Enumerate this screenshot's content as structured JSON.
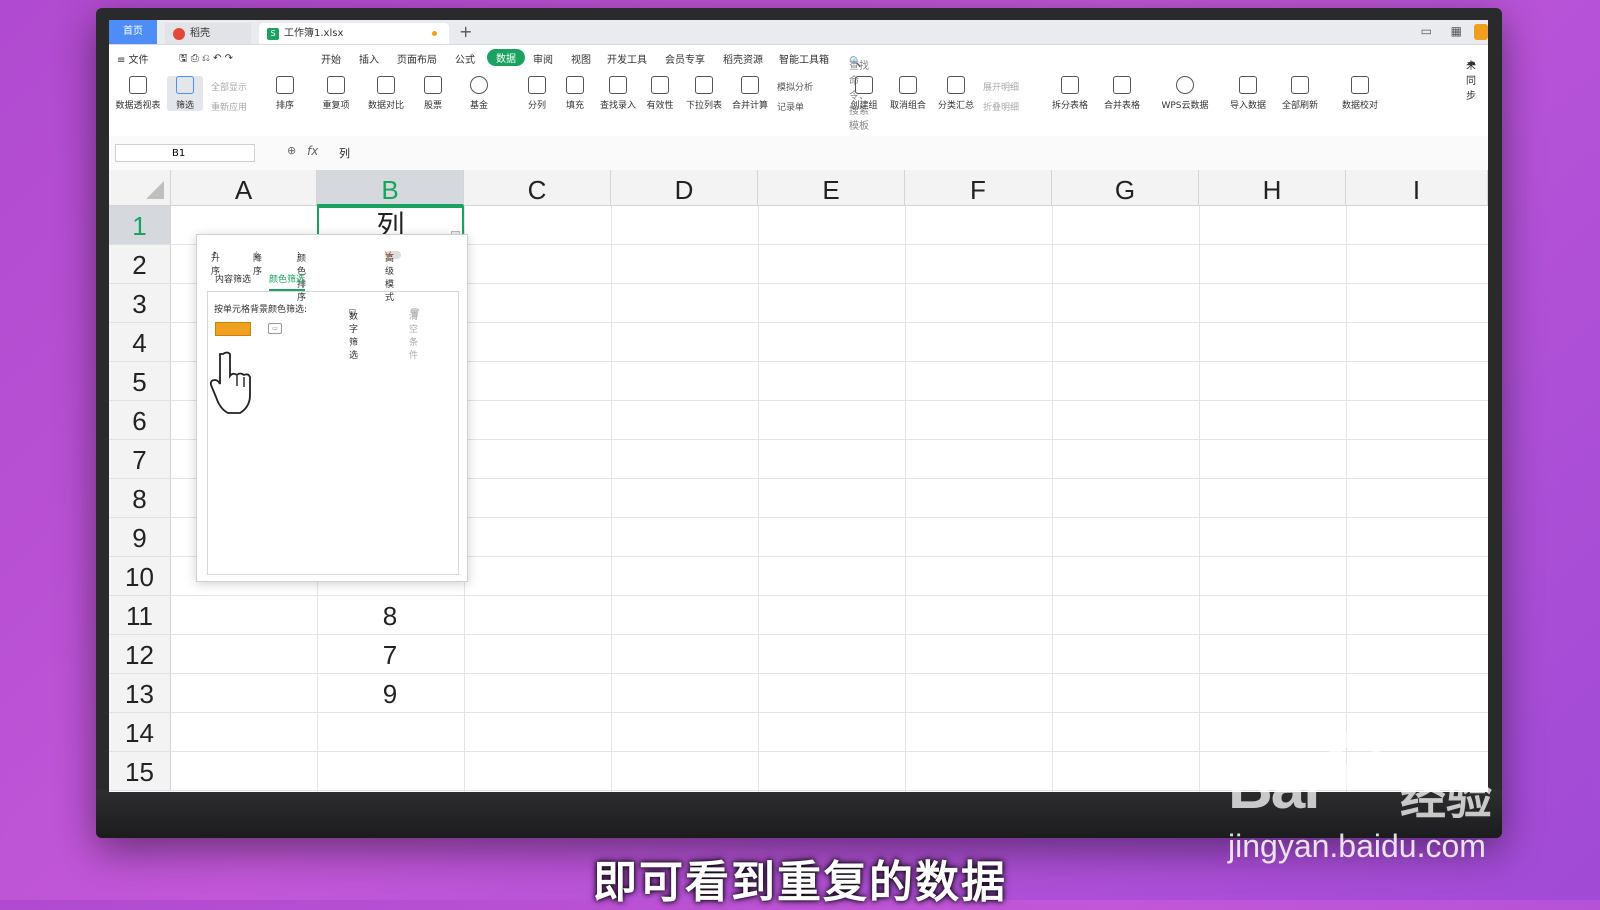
{
  "titlebar": {
    "home_tab": "首页",
    "doc_tab_1": "稻壳",
    "doc_tab_2": "工作簿1.xlsx",
    "new_tab": "+"
  },
  "menubar": {
    "file": "≡ 文件",
    "items": [
      "开始",
      "插入",
      "页面布局",
      "公式",
      "数据",
      "审阅",
      "视图",
      "开发工具",
      "会员专享",
      "稻壳资源",
      "智能工具箱"
    ],
    "active": "数据",
    "search_placeholder": "查找命令、搜索模板",
    "sync": "未同步"
  },
  "ribbon": {
    "pivot": "数据透视表",
    "filter": "筛选",
    "show_all": "全部显示",
    "reapply": "重新应用",
    "sort": "排序",
    "duplicates": "重复项",
    "compare": "数据对比",
    "stocks": "股票",
    "fund": "基金",
    "split": "分列",
    "fill": "填充",
    "lookup": "查找录入",
    "validity": "有效性",
    "dropdown": "下拉列表",
    "consolidate": "合并计算",
    "simulate": "模拟分析",
    "record": "记录单",
    "group": "创建组",
    "ungroup": "取消组合",
    "subtotal": "分类汇总",
    "expand": "展开明细",
    "collapse": "折叠明细",
    "split_table": "拆分表格",
    "merge_table": "合并表格",
    "wps_cloud": "WPS云数据",
    "import": "导入数据",
    "refresh_all": "全部刷新",
    "proofread": "数据校对"
  },
  "formula_bar": {
    "cell_ref": "B1",
    "fx": "fx",
    "value": "列"
  },
  "grid": {
    "columns": [
      "A",
      "B",
      "C",
      "D",
      "E",
      "F",
      "G",
      "H",
      "I"
    ],
    "selected_column": "B",
    "rows": [
      "1",
      "2",
      "3",
      "4",
      "5",
      "6",
      "7",
      "8",
      "9",
      "10",
      "11",
      "12",
      "13",
      "14",
      "15"
    ],
    "selected_row": "1",
    "b1": "列",
    "b11": "8",
    "b12": "7",
    "b13": "9"
  },
  "filter_popup": {
    "asc": "升序",
    "desc": "降序",
    "color_sort": "颜色排序",
    "advanced_mode": "高级模式",
    "content_filter": "内容筛选",
    "color_filter": "颜色筛选",
    "number_filter": "数字筛选",
    "clear": "清空条件",
    "bg_color_label": "按单元格背景颜色筛选:",
    "swatch_color": "#f0a020"
  },
  "caption": "即可看到重复的数据",
  "watermark": {
    "brand": "Bai",
    "brand_suffix": "经验",
    "url": "jingyan.baidu.com"
  },
  "colors": {
    "accent_green": "#1aa260",
    "home_tab_blue": "#4d8df5",
    "background_purple": "#b04ad0"
  }
}
